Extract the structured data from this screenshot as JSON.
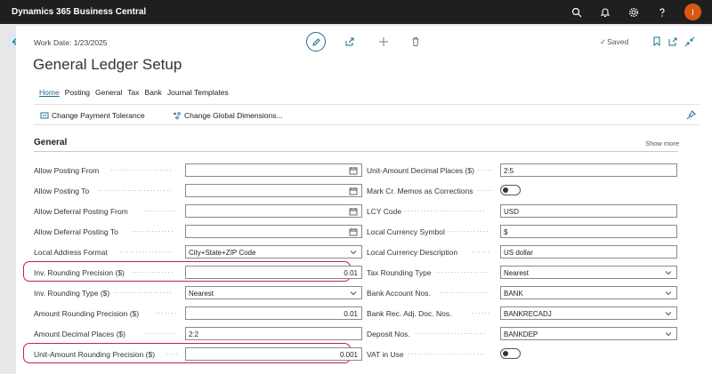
{
  "app": {
    "title": "Dynamics 365 Business Central",
    "avatar_initial": "I"
  },
  "page": {
    "work_date": "Work Date: 1/23/2025",
    "title": "General Ledger Setup",
    "saved_label": "Saved",
    "saved_check": "✓"
  },
  "tabs": [
    {
      "label": "Home"
    },
    {
      "label": "Posting"
    },
    {
      "label": "General"
    },
    {
      "label": "Tax"
    },
    {
      "label": "Bank"
    },
    {
      "label": "Journal Templates"
    }
  ],
  "actions": {
    "change_payment_tolerance": "Change Payment Tolerance",
    "change_global_dimensions": "Change Global Dimensions..."
  },
  "section": {
    "title": "General",
    "show_more": "Show more"
  },
  "left_fields": [
    {
      "label": "Allow Posting From",
      "value": ""
    },
    {
      "label": "Allow Posting To",
      "value": ""
    },
    {
      "label": "Allow Deferral Posting From",
      "value": ""
    },
    {
      "label": "Allow Deferral Posting To",
      "value": ""
    },
    {
      "label": "Local Address Format",
      "value": "City+State+ZIP Code"
    },
    {
      "label": "Inv. Rounding Precision ($)",
      "value": "0.01"
    },
    {
      "label": "Inv. Rounding Type ($)",
      "value": "Nearest"
    },
    {
      "label": "Amount Rounding Precision ($)",
      "value": "0.01"
    },
    {
      "label": "Amount Decimal Places ($)",
      "value": "2:2"
    },
    {
      "label": "Unit-Amount Rounding Precision ($)",
      "value": "0.001"
    }
  ],
  "right_fields": [
    {
      "label": "Unit-Amount Decimal Places ($)",
      "value": "2:5"
    },
    {
      "label": "Mark Cr. Memos as Corrections",
      "value": ""
    },
    {
      "label": "LCY Code",
      "value": "USD"
    },
    {
      "label": "Local Currency Symbol",
      "value": "$"
    },
    {
      "label": "Local Currency Description",
      "value": "US dollar"
    },
    {
      "label": "Tax Rounding Type",
      "value": "Nearest"
    },
    {
      "label": "Bank Account Nos.",
      "value": "BANK"
    },
    {
      "label": "Bank Rec. Adj. Doc. Nos.",
      "value": "BANKRECADJ"
    },
    {
      "label": "Deposit Nos.",
      "value": "BANKDEP"
    },
    {
      "label": "VAT in Use",
      "value": ""
    }
  ],
  "colors": {
    "accent": "#1f6e8a",
    "highlight": "#c0224a",
    "topbar": "#1f1f1f",
    "avatar": "#d85a11"
  }
}
